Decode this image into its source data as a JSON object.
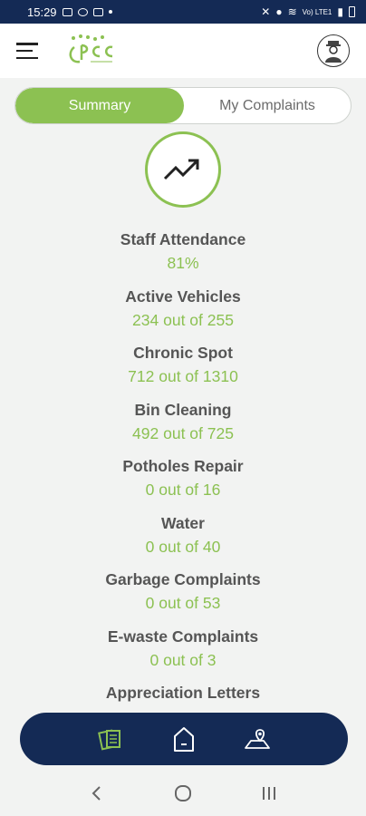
{
  "status_bar": {
    "time": "15:29",
    "network_label": "Vo) LTE1"
  },
  "tabs": [
    {
      "label": "Summary",
      "active": true
    },
    {
      "label": "My Complaints",
      "active": false
    }
  ],
  "stats": [
    {
      "label": "Staff Attendance",
      "value": "81%"
    },
    {
      "label": "Active Vehicles",
      "value": "234 out of 255"
    },
    {
      "label": "Chronic Spot",
      "value": "712 out of 1310"
    },
    {
      "label": "Bin Cleaning",
      "value": "492 out of 725"
    },
    {
      "label": "Potholes Repair",
      "value": "0 out of 16"
    },
    {
      "label": "Water",
      "value": "0 out of 40"
    },
    {
      "label": "Garbage Complaints",
      "value": "0 out of 53"
    },
    {
      "label": "E-waste Complaints",
      "value": "0 out of 3"
    },
    {
      "label": "Appreciation Letters",
      "value": ""
    }
  ],
  "colors": {
    "accent": "#8cc152",
    "navy": "#142a55"
  },
  "icons": {
    "header_left": "menu-icon",
    "logo": "pcc-logo",
    "profile": "avatar",
    "trend": "trending-up-icon",
    "bottom_nav": [
      "documents-icon",
      "home-icon",
      "map-pin-icon"
    ],
    "system_nav": [
      "back-icon",
      "home-circle-icon",
      "recents-icon"
    ]
  }
}
